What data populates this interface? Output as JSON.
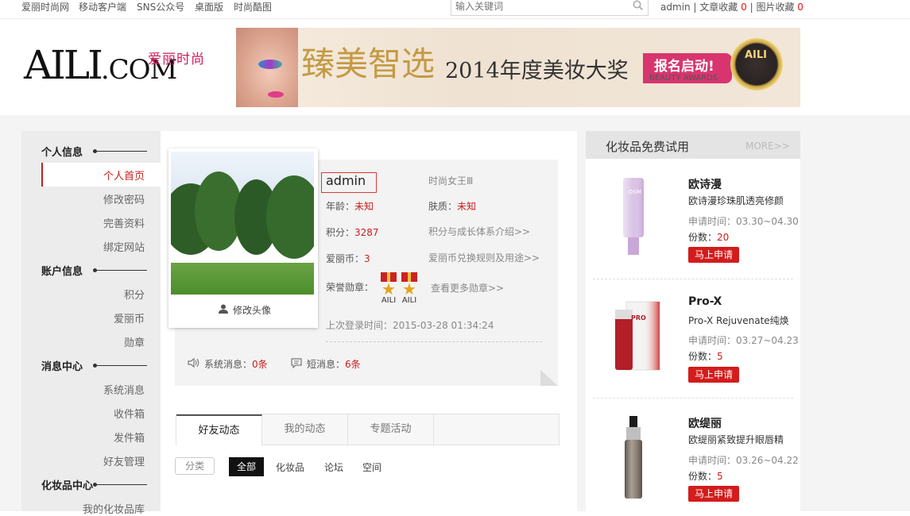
{
  "topbar": {
    "links": [
      "爱丽时尚网",
      "移动客户端",
      "SNS公众号",
      "桌面版",
      "时尚酷图"
    ],
    "search_placeholder": "输入关键词",
    "user": "admin",
    "fav_articles": "文章收藏",
    "fav_articles_count": "0",
    "fav_images": "图片收藏",
    "fav_images_count": "0"
  },
  "logo": {
    "text": "AILI",
    "dotcom": ".COM",
    "cn": "爱丽时尚"
  },
  "banner": {
    "title": "臻美智选",
    "subtitle": "2014年度美妆大奖",
    "cta": "报名启动!",
    "awards": "BEAUTY AWARDS",
    "medal": "AILI"
  },
  "sidebar": {
    "sections": [
      {
        "title": "个人信息",
        "items": [
          "个人首页",
          "修改密码",
          "完善资料",
          "绑定网站"
        ]
      },
      {
        "title": "账户信息",
        "items": [
          "积分",
          "爱丽币",
          "勋章"
        ]
      },
      {
        "title": "消息中心",
        "items": [
          "系统消息",
          "收件箱",
          "发件箱",
          "好友管理"
        ]
      },
      {
        "title": "化妆品中心",
        "items": [
          "我的化妆品库"
        ]
      }
    ]
  },
  "profile": {
    "edit_avatar": "修改头像",
    "username": "admin",
    "rank": "时尚女王Ⅲ",
    "age_label": "年龄：",
    "age": "未知",
    "skin_label": "肤质：",
    "skin": "未知",
    "points_label": "积分：",
    "points": "3287",
    "points_link": "积分与成长体系介绍>>",
    "coins_label": "爱丽币：",
    "coins": "3",
    "coins_link": "爱丽币兑换规则及用途>>",
    "medals_label": "荣誉勋章：",
    "medals": [
      "AILI",
      "AILI"
    ],
    "medals_link": "查看更多勋章>>",
    "last_login": "上次登录时间：2015-03-28 01:34:24",
    "sys_msg_label": "系统消息：",
    "sys_msg": "0条",
    "short_msg_label": "短消息：",
    "short_msg": "6条"
  },
  "tabs": [
    "好友动态",
    "我的动态",
    "专题活动"
  ],
  "filter": {
    "label": "分类",
    "options": [
      "全部",
      "化妆品",
      "论坛",
      "空间"
    ]
  },
  "trial": {
    "title": "化妆品免费试用",
    "more": "MORE>>",
    "date_label": "申请时间：",
    "count_label": "份数：",
    "apply": "马上申请",
    "products": [
      {
        "brand": "欧诗漫",
        "name": "欧诗漫珍珠肌透亮修颜",
        "date": "03.30~04.30",
        "count": "20"
      },
      {
        "brand": "Pro-X",
        "name": "Pro-X Rejuvenate纯焕",
        "date": "03.27~04.23",
        "count": "5"
      },
      {
        "brand": "欧缇丽",
        "name": "欧缇丽紧致提升眼唇精",
        "date": "03.26~04.22",
        "count": "5"
      }
    ]
  },
  "colors": {
    "accent": "#c81e1e",
    "apply_bg": "#d31c1c",
    "logo_pink": "#d01b5d"
  }
}
